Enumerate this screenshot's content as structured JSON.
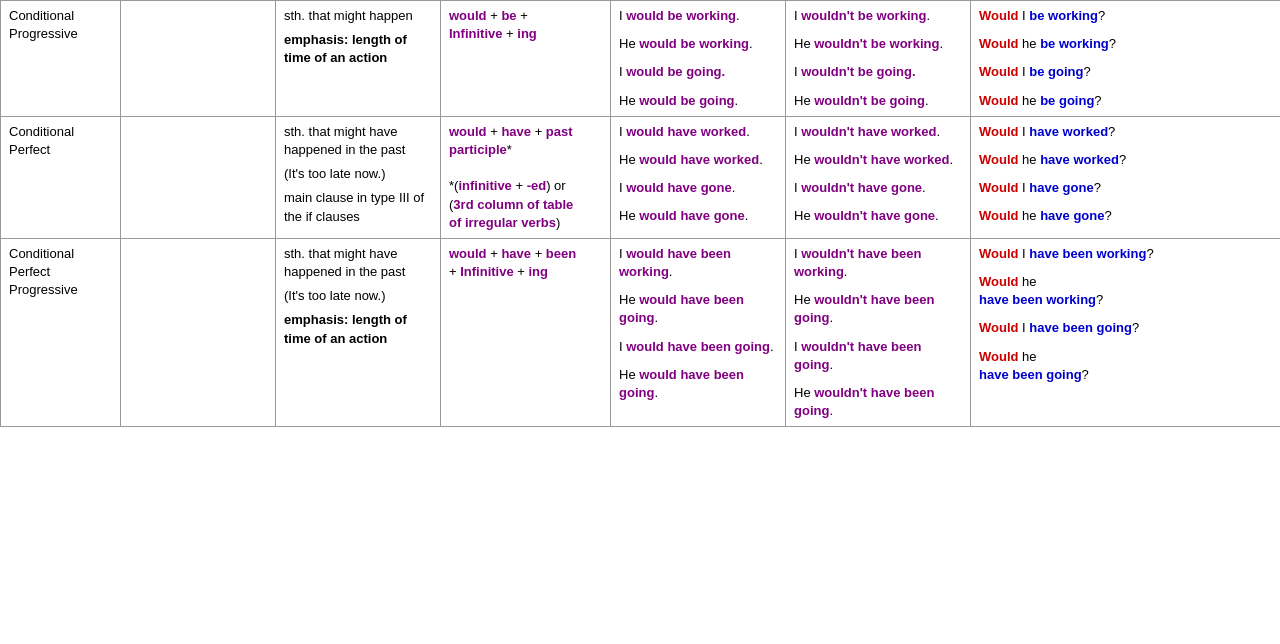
{
  "table": {
    "rows": [
      {
        "tense": "Conditional\nProgressive",
        "col2": "",
        "usage": "sth. that might happen\n\nemphasis: length of time of an action",
        "formula": "would + be + Infinitive + ing",
        "affirmative": [
          "I would be working.",
          "He would be working.",
          "I would be going.",
          "He would be going."
        ],
        "negative": [
          "I wouldn't be working.",
          "He wouldn't be working.",
          "I wouldn't be going.",
          "He wouldn't be going."
        ],
        "question": [
          "Would I be working?",
          "Would he be working?",
          "Would I be going?",
          "Would he be going?"
        ]
      },
      {
        "tense": "Conditional\nPerfect",
        "col2": "",
        "usage": "sth. that might have happened in the past\n\n(It's too late now.)\n\nmain clause in type III of the if clauses",
        "formula": "would + have + past participle*\n\n*(infinitive + -ed) or (3rd column of table of irregular verbs)",
        "affirmative": [
          "I would have worked.",
          "He would have worked.",
          "I would have gone.",
          "He would have gone."
        ],
        "negative": [
          "I wouldn't have worked.",
          "He wouldn't have worked.",
          "I wouldn't have gone.",
          "He wouldn't have gone."
        ],
        "question": [
          "Would I have worked?",
          "Would he have worked?",
          "Would I have gone?",
          "Would he have gone?"
        ]
      },
      {
        "tense": "Conditional\nPerfect\nProgressive",
        "col2": "",
        "usage": "sth. that might have happened in the past\n\n(It's too late now.)\n\nemphasis: length of time of an action",
        "formula": "would + have + been + Infinitive + ing",
        "affirmative": [
          "I would have been working.",
          "He would have been going.",
          "I would have been going.",
          "He would have been going."
        ],
        "negative": [
          "I wouldn't have been working.",
          "He wouldn't have been going.",
          "I wouldn't have been going.",
          "He wouldn't have been going."
        ],
        "question": [
          "Would I have been working?",
          "Would he have been working?",
          "Would I have been going?",
          "Would he have been going?"
        ]
      }
    ]
  }
}
